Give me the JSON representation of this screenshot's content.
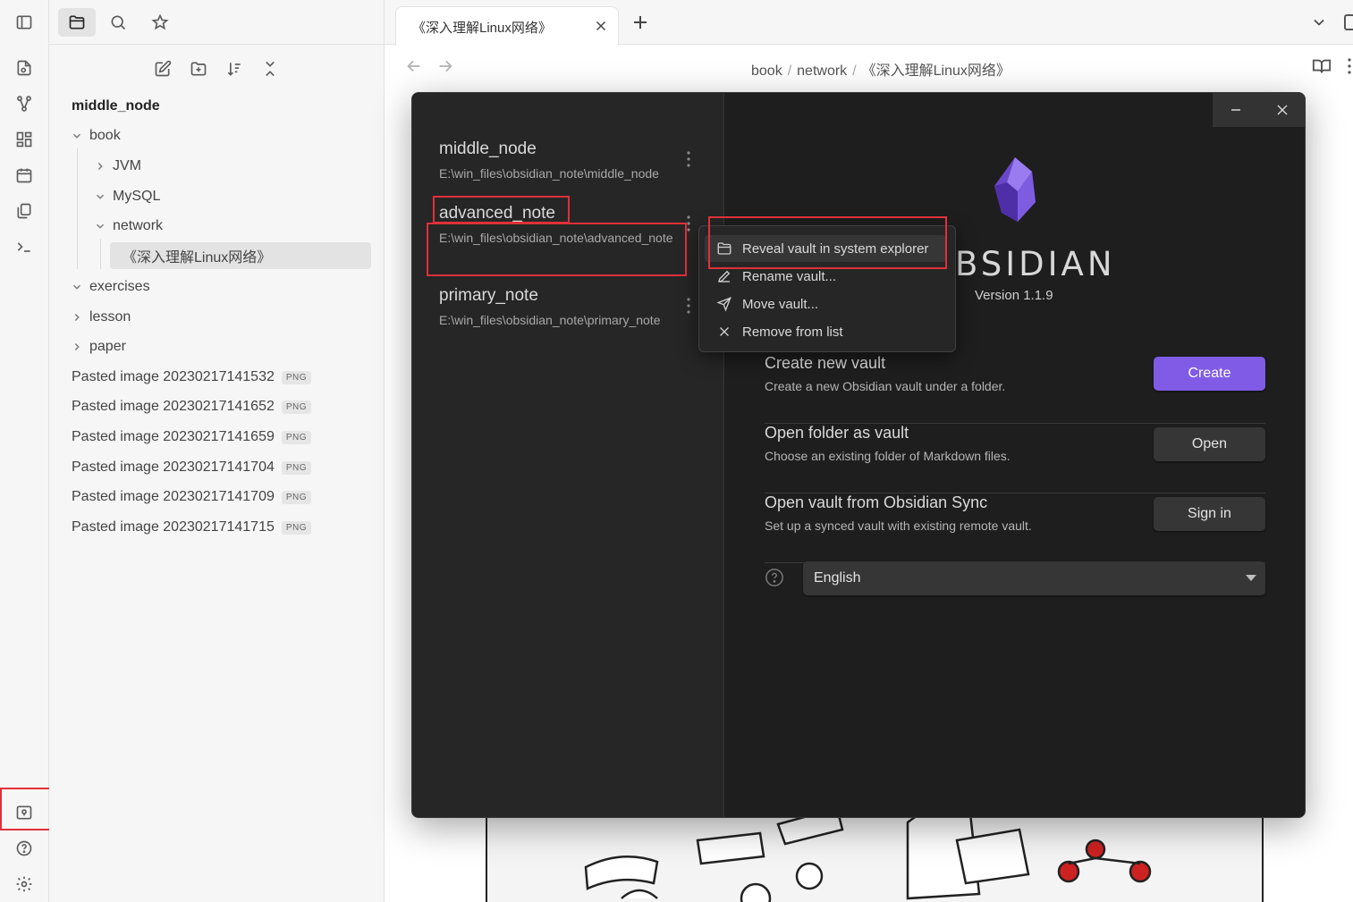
{
  "ribbon": {
    "items": [
      {
        "icon": "open-quick-switcher-icon"
      },
      {
        "icon": "graph-view-icon"
      },
      {
        "icon": "canvas-icon"
      },
      {
        "icon": "daily-note-icon"
      },
      {
        "icon": "templates-icon"
      },
      {
        "icon": "command-palette-icon"
      }
    ],
    "bottom": [
      {
        "icon": "vault-switcher-icon"
      },
      {
        "icon": "help-icon"
      },
      {
        "icon": "settings-icon"
      }
    ]
  },
  "sidebar": {
    "vault_name": "middle_node",
    "tree": [
      {
        "label": "book",
        "type": "folder",
        "expanded": true
      },
      {
        "label": "JVM",
        "type": "folder",
        "expanded": false
      },
      {
        "label": "MySQL",
        "type": "folder",
        "expanded": true
      },
      {
        "label": "network",
        "type": "folder",
        "expanded": true
      },
      {
        "label": "《深入理解Linux网络》",
        "type": "file",
        "selected": true
      },
      {
        "label": "exercises",
        "type": "folder",
        "expanded": true
      },
      {
        "label": "lesson",
        "type": "folder",
        "expanded": false
      },
      {
        "label": "paper",
        "type": "folder",
        "expanded": false
      },
      {
        "label": "Pasted image 20230217141532",
        "type": "file",
        "badge": "PNG"
      },
      {
        "label": "Pasted image 20230217141652",
        "type": "file",
        "badge": "PNG"
      },
      {
        "label": "Pasted image 20230217141659",
        "type": "file",
        "badge": "PNG"
      },
      {
        "label": "Pasted image 20230217141704",
        "type": "file",
        "badge": "PNG"
      },
      {
        "label": "Pasted image 20230217141709",
        "type": "file",
        "badge": "PNG"
      },
      {
        "label": "Pasted image 20230217141715",
        "type": "file",
        "badge": "PNG"
      }
    ]
  },
  "tabs": [
    {
      "title": "《深入理解Linux网络》",
      "active": true
    }
  ],
  "breadcrumb": [
    "book",
    "network",
    "《深入理解Linux网络》"
  ],
  "vault_modal": {
    "vaults": [
      {
        "name": "middle_node",
        "path": "E:\\win_files\\obsidian_note\\middle_node"
      },
      {
        "name": "advanced_note",
        "path": "E:\\win_files\\obsidian_note\\advanced_note"
      },
      {
        "name": "primary_note",
        "path": "E:\\win_files\\obsidian_note\\primary_note"
      }
    ],
    "brand": "BSIDIAN",
    "version": "Version 1.1.9",
    "actions": [
      {
        "title": "Create new vault",
        "desc": "Create a new Obsidian vault under a folder.",
        "button": "Create",
        "primary": true
      },
      {
        "title": "Open folder as vault",
        "desc": "Choose an existing folder of Markdown files.",
        "button": "Open",
        "primary": false
      },
      {
        "title": "Open vault from Obsidian Sync",
        "desc": "Set up a synced vault with existing remote vault.",
        "button": "Sign in",
        "primary": false
      }
    ],
    "language": "English",
    "accent_color": "#7f5be6"
  },
  "context_menu": {
    "items": [
      {
        "label": "Reveal vault in system explorer",
        "icon": "folder-open-icon",
        "hover": true
      },
      {
        "label": "Rename vault...",
        "icon": "pencil-icon"
      },
      {
        "label": "Move vault...",
        "icon": "send-icon"
      },
      {
        "label": "Remove from list",
        "icon": "x-icon"
      }
    ]
  },
  "highlight_color": "#e0303a"
}
